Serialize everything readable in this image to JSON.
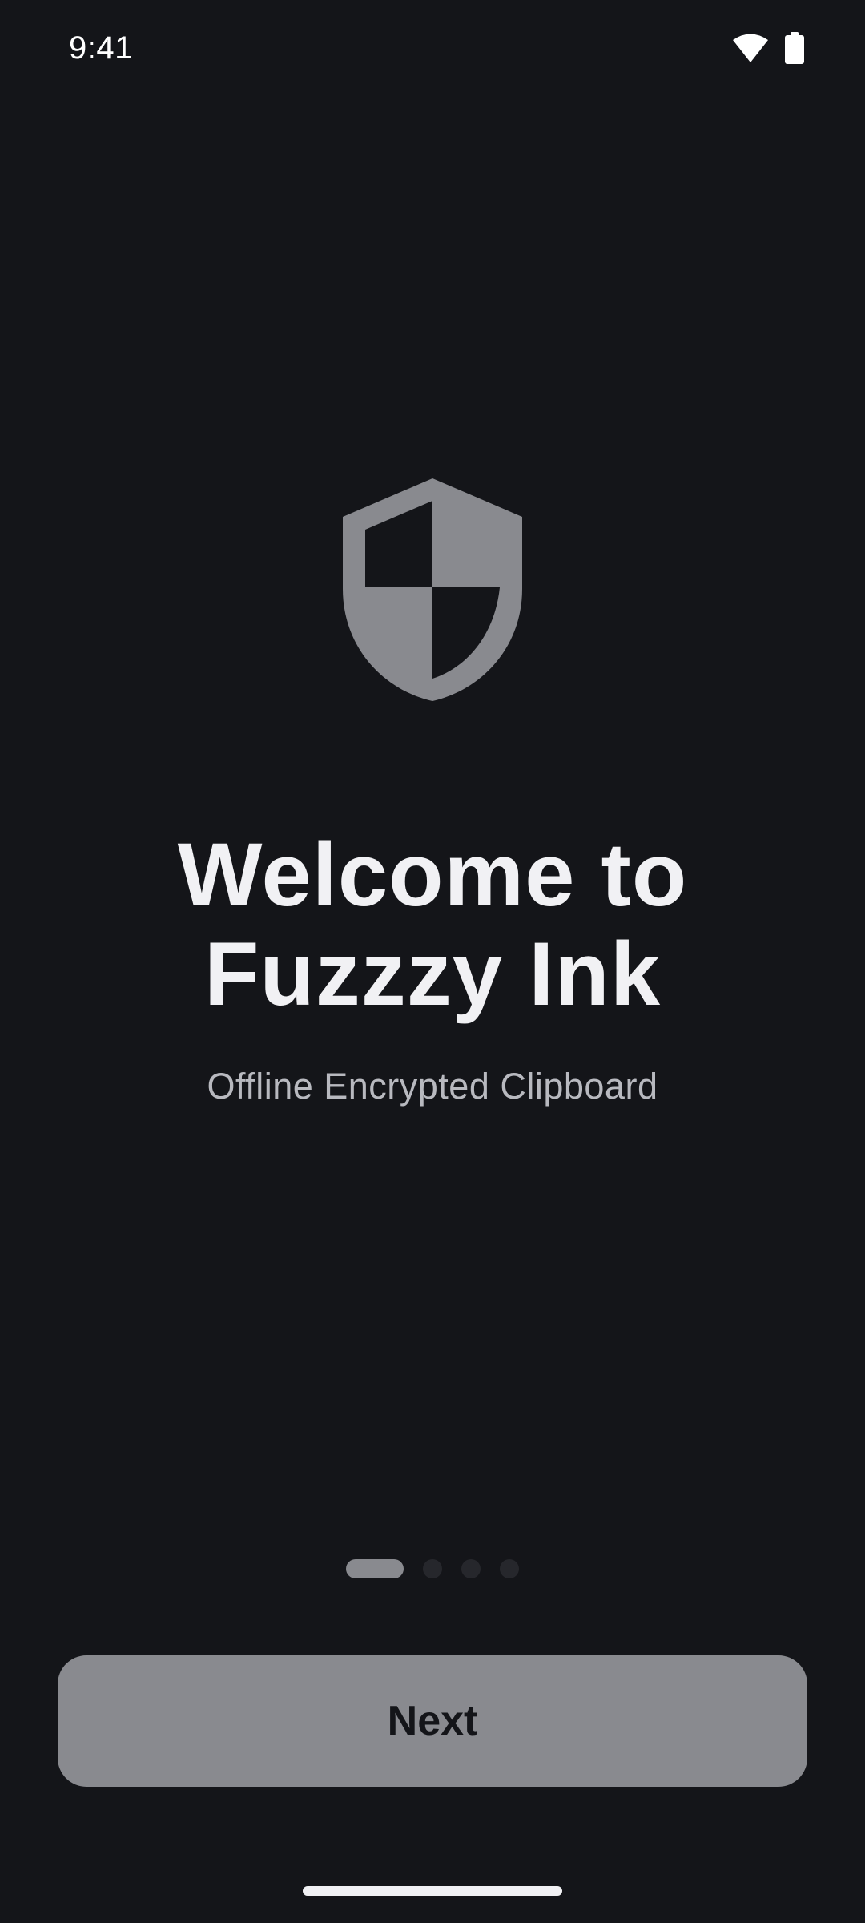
{
  "status_bar": {
    "time": "9:41",
    "icons": [
      "wifi-icon",
      "battery-icon"
    ]
  },
  "hero": {
    "icon": "shield-icon"
  },
  "welcome": {
    "title_line1": "Welcome to",
    "title_line2": "Fuzzzy Ink",
    "subtitle": "Offline Encrypted Clipboard"
  },
  "pager": {
    "total_pages": 4,
    "current_page": 1
  },
  "actions": {
    "next_label": "Next"
  },
  "colors": {
    "background": "#141519",
    "accent": "#898a8f",
    "title": "#f1f1f4",
    "subtitle": "#b8b9bf"
  }
}
